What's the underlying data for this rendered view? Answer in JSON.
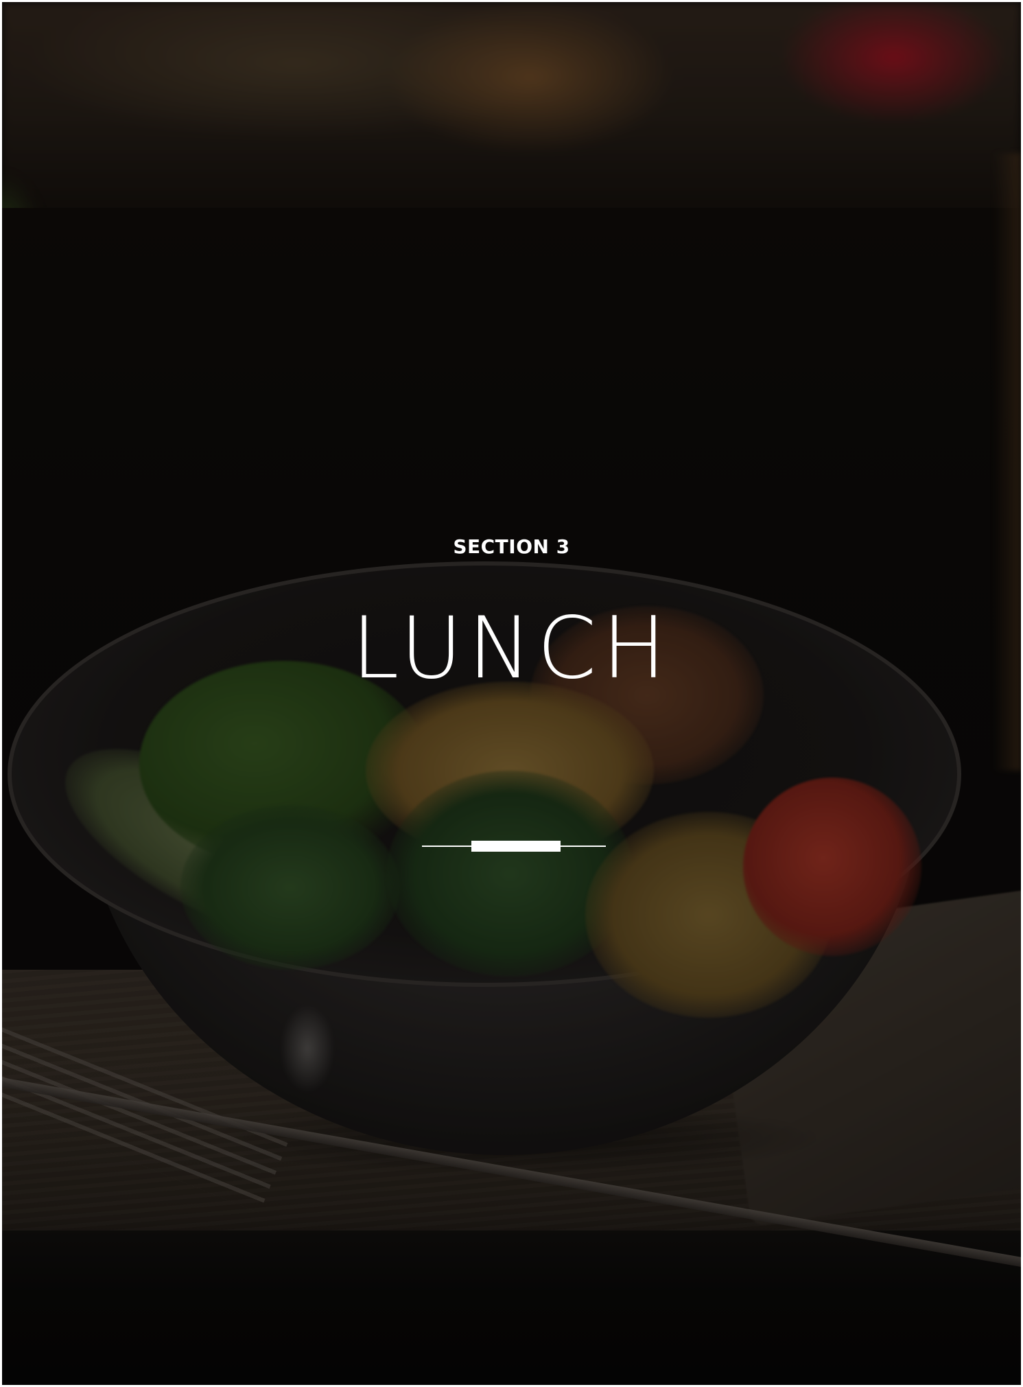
{
  "section_label": "SECTION 3",
  "title": "LUNCH",
  "background_image": "salad-bowl-photo",
  "colors": {
    "text": "#ffffff",
    "divider": "#ffffff"
  }
}
